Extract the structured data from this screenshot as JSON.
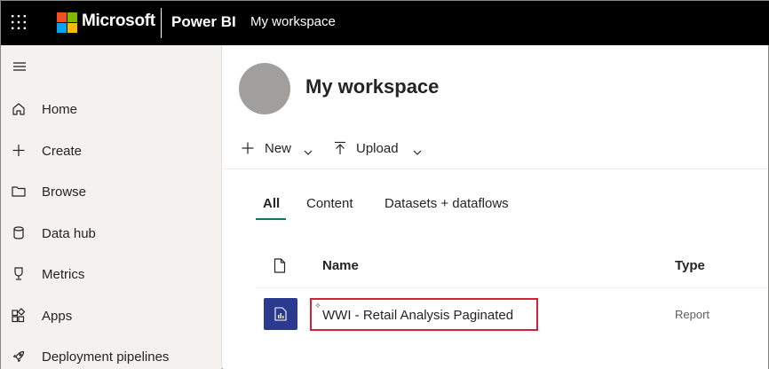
{
  "topbar": {
    "brand": "Microsoft",
    "product": "Power BI",
    "workspace_crumb": "My workspace"
  },
  "sidebar": {
    "items": [
      {
        "label": "Home",
        "icon": "home-icon"
      },
      {
        "label": "Create",
        "icon": "plus-icon"
      },
      {
        "label": "Browse",
        "icon": "folder-icon"
      },
      {
        "label": "Data hub",
        "icon": "database-icon"
      },
      {
        "label": "Metrics",
        "icon": "trophy-icon"
      },
      {
        "label": "Apps",
        "icon": "apps-icon"
      },
      {
        "label": "Deployment pipelines",
        "icon": "rocket-icon"
      }
    ]
  },
  "workspace": {
    "title": "My workspace"
  },
  "toolbar": {
    "new_label": "New",
    "upload_label": "Upload"
  },
  "tabs": [
    {
      "label": "All",
      "active": true
    },
    {
      "label": "Content",
      "active": false
    },
    {
      "label": "Datasets + dataflows",
      "active": false
    }
  ],
  "table": {
    "columns": {
      "name": "Name",
      "type": "Type"
    },
    "rows": [
      {
        "name": "WWI - Retail Analysis Paginated",
        "type": "Report"
      }
    ]
  },
  "colors": {
    "topbar_bg": "#000000",
    "sidebar_bg": "#f3f2f1",
    "tab_accent": "#117865",
    "report_icon_bg": "#2b3a8f",
    "highlight_border": "#d4203b"
  }
}
